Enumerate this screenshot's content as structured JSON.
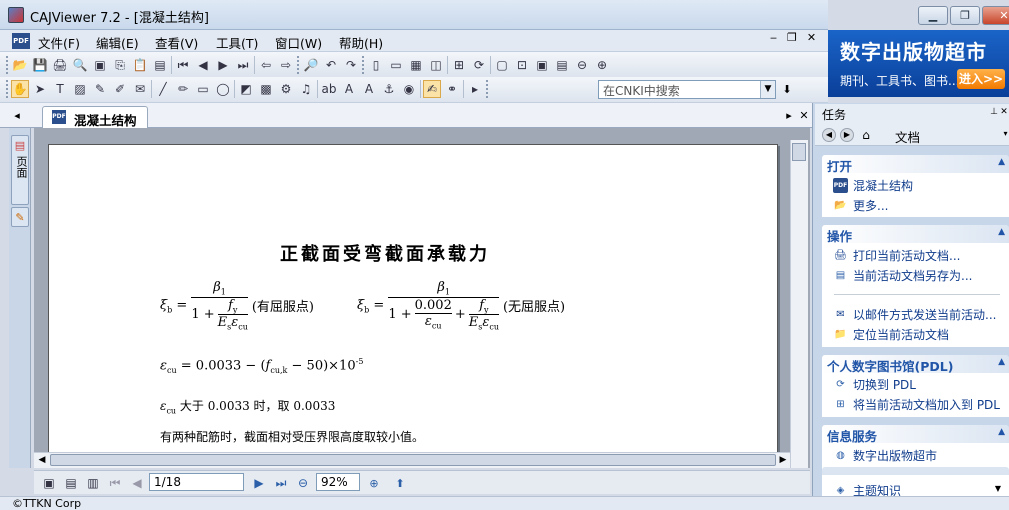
{
  "window": {
    "title": "CAJViewer 7.2 - [混凝土结构]"
  },
  "menu": [
    "文件(F)",
    "编辑(E)",
    "查看(V)",
    "工具(T)",
    "窗口(W)",
    "帮助(H)"
  ],
  "toolbar": {
    "search_placeholder": "在CNKI中搜索"
  },
  "ad": {
    "title": "数字出版物超市",
    "subtitle": "期刊、工具书、图书...",
    "button": "进入>>"
  },
  "tab": {
    "label": "混凝土结构"
  },
  "sidebar": {
    "outline_label": "页面"
  },
  "document": {
    "heading": "正截面受弯截面承载力",
    "formula1_label": "(有屈服点)",
    "formula2_label": "(无屈服点)",
    "formula2_const": "0.002",
    "formula3_const": "0.0033",
    "formula3_num": "50",
    "formula3_exp": "-5",
    "line1": "大于 0.0033 时，取 0.0033",
    "line2": "有两种配筋时，截面相对受压界限高度取较小值。"
  },
  "nav": {
    "page": "1/18",
    "zoom": "92%"
  },
  "status": {
    "text": "©TTKN Corp"
  },
  "taskpane": {
    "title": "任务",
    "nav_label": "文档",
    "sections": [
      {
        "title": "打开",
        "items": [
          "混凝土结构",
          "更多..."
        ]
      },
      {
        "title": "操作",
        "items": [
          "打印当前活动文档...",
          "当前活动文档另存为...",
          "以邮件方式发送当前活动...",
          "定位当前活动文档"
        ]
      },
      {
        "title": "个人数字图书馆(PDL)",
        "items": [
          "切换到 PDL",
          "将当前活动文档加入到 PDL"
        ]
      },
      {
        "title": "信息服务",
        "items": [
          "数字出版物超市",
          "主题知识"
        ]
      }
    ]
  }
}
